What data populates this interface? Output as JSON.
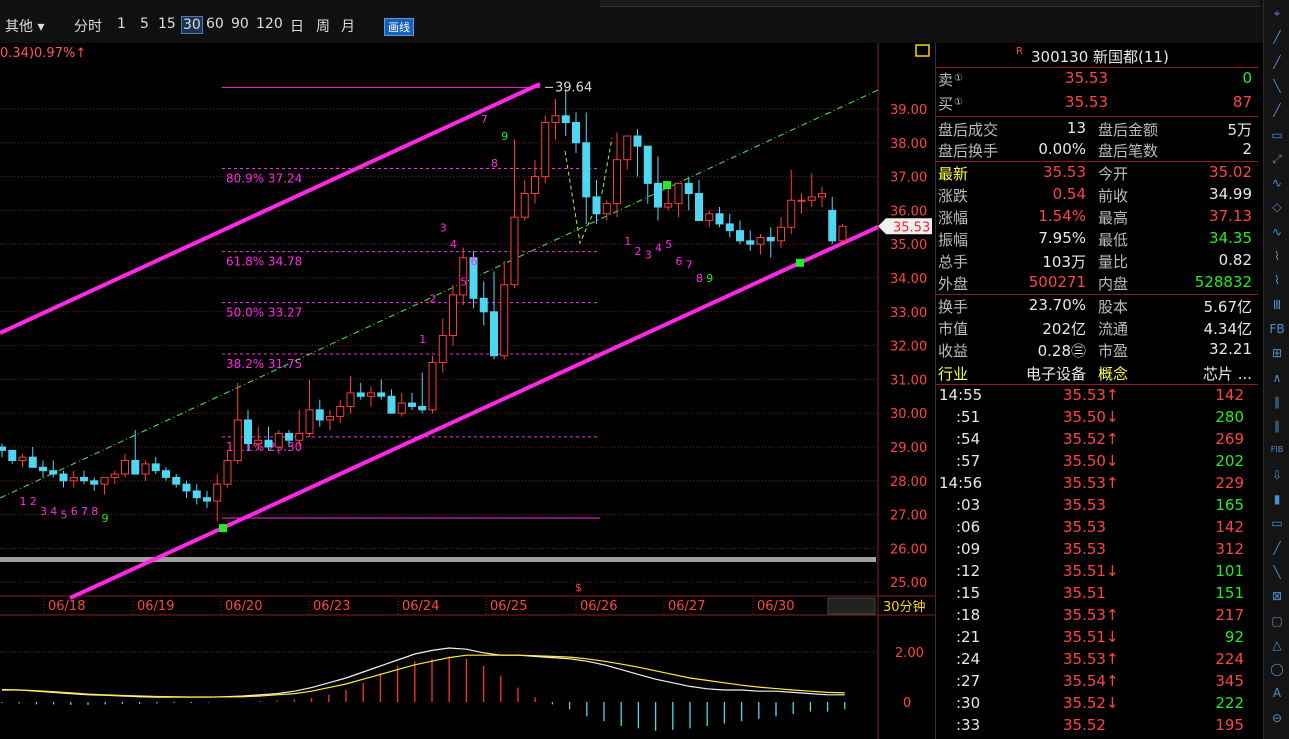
{
  "toolbar": {
    "other": "其他 ▾",
    "periods": [
      "分时",
      "1",
      "5",
      "15",
      "30",
      "60",
      "90",
      "120",
      "日",
      "周",
      "月"
    ],
    "active_period": "30",
    "draw_button": "画线"
  },
  "chart_info": {
    "change_text": "0.34)0.97%↑",
    "period_label": "30分钟",
    "current_price_tag": "35.53"
  },
  "colors": {
    "up": "#ff3b3b",
    "down": "#4fd6f0",
    "magenta": "#ff28e6",
    "grid": "#7a1c1c",
    "green_marker": "#22ee22"
  },
  "chart_data": {
    "type": "candlestick",
    "title": "",
    "y_ticks": [
      "39.00",
      "38.00",
      "37.00",
      "36.00",
      "35.00",
      "34.00",
      "33.00",
      "32.00",
      "31.00",
      "30.00",
      "29.00",
      "28.00",
      "27.00",
      "26.00",
      "25.00"
    ],
    "ylim": [
      24.5,
      40.4
    ],
    "x_labels": [
      "06/18",
      "06/19",
      "06/20",
      "06/23",
      "06/24",
      "06/25",
      "06/26",
      "06/27",
      "06/30"
    ],
    "high_annotation": "39.64",
    "fibonacci": [
      {
        "label": "80.9% 37.24",
        "value": 37.24
      },
      {
        "label": "61.8% 34.78",
        "value": 34.78
      },
      {
        "label": "50.0% 33.27",
        "value": 33.27
      },
      {
        "label": "38.2% 31.75",
        "value": 31.75
      },
      {
        "label": "19.1% 29.30",
        "value": 29.3
      }
    ],
    "candles": [
      [
        29.0,
        29.1,
        28.7,
        28.9
      ],
      [
        28.9,
        28.9,
        28.5,
        28.6
      ],
      [
        28.6,
        28.8,
        28.4,
        28.7
      ],
      [
        28.7,
        29.0,
        28.5,
        28.4
      ],
      [
        28.4,
        28.6,
        28.1,
        28.3
      ],
      [
        28.3,
        28.6,
        28.1,
        28.2
      ],
      [
        28.2,
        28.3,
        27.8,
        28.0
      ],
      [
        28.0,
        28.3,
        27.8,
        28.1
      ],
      [
        28.1,
        28.3,
        27.9,
        28.0
      ],
      [
        28.0,
        28.1,
        27.7,
        27.9
      ],
      [
        27.9,
        28.1,
        27.6,
        28.1
      ],
      [
        28.1,
        28.3,
        27.9,
        28.2
      ],
      [
        28.2,
        28.8,
        28.1,
        28.6
      ],
      [
        28.6,
        29.5,
        28.4,
        28.2
      ],
      [
        28.2,
        28.6,
        28.0,
        28.5
      ],
      [
        28.5,
        28.7,
        28.2,
        28.3
      ],
      [
        28.3,
        28.4,
        28.0,
        28.1
      ],
      [
        28.1,
        28.2,
        27.8,
        27.9
      ],
      [
        27.9,
        28.0,
        27.5,
        27.7
      ],
      [
        27.7,
        27.9,
        27.3,
        27.5
      ],
      [
        27.5,
        27.7,
        27.2,
        27.4
      ],
      [
        27.4,
        28.2,
        26.8,
        27.9
      ],
      [
        27.9,
        28.9,
        27.8,
        28.6
      ],
      [
        28.6,
        30.9,
        28.5,
        29.8
      ],
      [
        29.8,
        30.1,
        28.9,
        29.1
      ],
      [
        29.1,
        29.6,
        28.9,
        29.2
      ],
      [
        29.2,
        29.6,
        28.9,
        29.0
      ],
      [
        29.0,
        29.5,
        28.8,
        29.4
      ],
      [
        29.4,
        29.5,
        29.0,
        29.2
      ],
      [
        29.2,
        30.1,
        29.0,
        29.4
      ],
      [
        29.4,
        31.0,
        29.3,
        30.1
      ],
      [
        30.1,
        30.4,
        29.6,
        29.8
      ],
      [
        29.8,
        30.1,
        29.5,
        29.9
      ],
      [
        29.9,
        30.4,
        29.7,
        30.2
      ],
      [
        30.2,
        31.1,
        30.0,
        30.6
      ],
      [
        30.6,
        30.9,
        30.4,
        30.5
      ],
      [
        30.5,
        30.8,
        30.2,
        30.6
      ],
      [
        30.6,
        31.0,
        30.4,
        30.5
      ],
      [
        30.5,
        30.7,
        30.0,
        30.0
      ],
      [
        30.0,
        30.6,
        29.9,
        30.3
      ],
      [
        30.3,
        30.6,
        30.1,
        30.2
      ],
      [
        30.2,
        31.2,
        30.0,
        30.1
      ],
      [
        30.1,
        31.7,
        30.0,
        31.5
      ],
      [
        31.5,
        32.8,
        31.2,
        32.3
      ],
      [
        32.3,
        33.8,
        32.0,
        33.5
      ],
      [
        33.5,
        34.9,
        33.2,
        34.6
      ],
      [
        34.6,
        34.8,
        33.1,
        33.4
      ],
      [
        33.4,
        33.9,
        32.6,
        33.0
      ],
      [
        33.0,
        34.2,
        31.6,
        31.7
      ],
      [
        31.7,
        34.5,
        31.6,
        33.8
      ],
      [
        33.8,
        38.1,
        33.7,
        35.8
      ],
      [
        35.8,
        36.9,
        35.7,
        36.5
      ],
      [
        36.5,
        37.5,
        36.2,
        37.0
      ],
      [
        37.0,
        38.8,
        36.8,
        38.6
      ],
      [
        38.6,
        39.3,
        38.1,
        38.8
      ],
      [
        38.8,
        39.6,
        38.2,
        38.6
      ],
      [
        38.6,
        38.9,
        37.7,
        38.0
      ],
      [
        38.0,
        38.9,
        35.6,
        36.4
      ],
      [
        36.4,
        36.9,
        35.6,
        35.9
      ],
      [
        35.9,
        36.3,
        35.7,
        36.2
      ],
      [
        36.2,
        38.3,
        35.8,
        37.5
      ],
      [
        37.5,
        38.0,
        37.2,
        38.2
      ],
      [
        38.2,
        38.4,
        37.0,
        37.9
      ],
      [
        37.9,
        37.9,
        36.2,
        36.8
      ],
      [
        36.8,
        37.6,
        35.7,
        36.1
      ],
      [
        36.1,
        36.8,
        36.0,
        36.2
      ],
      [
        36.2,
        36.6,
        35.8,
        36.8
      ],
      [
        36.8,
        37.0,
        36.0,
        36.5
      ],
      [
        36.5,
        36.9,
        35.7,
        35.7
      ],
      [
        35.7,
        36.0,
        35.5,
        35.9
      ],
      [
        35.9,
        36.1,
        35.5,
        35.6
      ],
      [
        35.6,
        35.9,
        35.2,
        35.4
      ],
      [
        35.4,
        35.7,
        35.0,
        35.1
      ],
      [
        35.1,
        35.4,
        34.8,
        35.0
      ],
      [
        35.0,
        35.3,
        34.7,
        35.2
      ],
      [
        35.2,
        35.5,
        34.6,
        35.1
      ],
      [
        35.1,
        35.8,
        34.9,
        35.5
      ],
      [
        35.5,
        37.2,
        35.3,
        36.3
      ],
      [
        36.3,
        36.5,
        35.9,
        36.3
      ],
      [
        36.3,
        37.1,
        36.1,
        36.4
      ],
      [
        36.4,
        36.7,
        36.1,
        36.5
      ],
      [
        36.0,
        36.4,
        35.0,
        35.1
      ],
      [
        35.1,
        35.6,
        35.0,
        35.53
      ]
    ],
    "td_labels": [
      {
        "text": "1",
        "i": 2,
        "v": 27.4,
        "c": "m"
      },
      {
        "text": "2",
        "i": 3,
        "v": 27.4,
        "c": "m"
      },
      {
        "text": "3",
        "i": 4,
        "v": 27.1,
        "c": "m"
      },
      {
        "text": "4",
        "i": 5,
        "v": 27.1,
        "c": "m"
      },
      {
        "text": "5",
        "i": 6,
        "v": 27.0,
        "c": "m"
      },
      {
        "text": "6",
        "i": 7,
        "v": 27.1,
        "c": "m"
      },
      {
        "text": "7",
        "i": 8,
        "v": 27.1,
        "c": "m"
      },
      {
        "text": "8",
        "i": 9,
        "v": 27.1,
        "c": "m"
      },
      {
        "text": "9",
        "i": 10,
        "v": 26.9,
        "c": "g"
      },
      {
        "text": "1",
        "i": 41,
        "v": 32.2,
        "c": "m"
      },
      {
        "text": "2",
        "i": 42,
        "v": 33.4,
        "c": "m"
      },
      {
        "text": "3",
        "i": 43,
        "v": 35.5,
        "c": "m"
      },
      {
        "text": "4",
        "i": 44,
        "v": 35.0,
        "c": "m"
      },
      {
        "text": "5",
        "i": 45,
        "v": 33.9,
        "c": "m"
      },
      {
        "text": "6",
        "i": 46,
        "v": 34.5,
        "c": "m"
      },
      {
        "text": "7",
        "i": 47,
        "v": 38.7,
        "c": "m"
      },
      {
        "text": "8",
        "i": 48,
        "v": 37.4,
        "c": "m"
      },
      {
        "text": "9",
        "i": 49,
        "v": 38.2,
        "c": "g"
      },
      {
        "text": "1",
        "i": 61,
        "v": 35.1,
        "c": "m"
      },
      {
        "text": "2",
        "i": 62,
        "v": 34.8,
        "c": "m"
      },
      {
        "text": "3",
        "i": 63,
        "v": 34.7,
        "c": "m"
      },
      {
        "text": "4",
        "i": 64,
        "v": 34.9,
        "c": "m"
      },
      {
        "text": "5",
        "i": 65,
        "v": 35.0,
        "c": "m"
      },
      {
        "text": "6",
        "i": 66,
        "v": 34.5,
        "c": "m"
      },
      {
        "text": "7",
        "i": 67,
        "v": 34.4,
        "c": "m"
      },
      {
        "text": "8",
        "i": 68,
        "v": 34.0,
        "c": "m"
      },
      {
        "text": "9",
        "i": 69,
        "v": 34.0,
        "c": "g"
      }
    ],
    "macd": {
      "hist": [
        -0.02,
        -0.03,
        -0.05,
        -0.05,
        -0.06,
        -0.06,
        -0.05,
        -0.04,
        -0.04,
        -0.03,
        -0.02,
        -0.02,
        -0.01,
        0.0,
        0.01,
        0.02,
        0.03,
        0.05,
        0.08,
        0.15,
        0.25,
        0.4,
        0.6,
        0.75,
        0.85,
        0.9,
        0.95,
        0.9,
        0.75,
        0.55,
        0.3,
        0.1,
        -0.05,
        -0.15,
        -0.3,
        -0.4,
        -0.5,
        -0.55,
        -0.6,
        -0.58,
        -0.55,
        -0.5,
        -0.45,
        -0.4,
        -0.35,
        -0.3,
        -0.25,
        -0.2,
        -0.2,
        -0.15
      ],
      "dif": [
        0.5,
        0.5,
        0.45,
        0.4,
        0.35,
        0.3,
        0.28,
        0.25,
        0.22,
        0.2,
        0.2,
        0.2,
        0.2,
        0.22,
        0.25,
        0.3,
        0.35,
        0.45,
        0.6,
        0.8,
        1.0,
        1.25,
        1.5,
        1.75,
        2.0,
        2.15,
        2.25,
        2.2,
        2.05,
        1.95,
        1.95,
        1.9,
        1.85,
        1.8,
        1.7,
        1.55,
        1.35,
        1.15,
        0.95,
        0.8,
        0.65,
        0.55,
        0.5,
        0.5,
        0.45,
        0.45,
        0.4,
        0.35,
        0.3,
        0.3
      ],
      "dea": [
        0.52,
        0.5,
        0.47,
        0.43,
        0.38,
        0.33,
        0.3,
        0.27,
        0.25,
        0.23,
        0.22,
        0.21,
        0.21,
        0.21,
        0.22,
        0.25,
        0.3,
        0.35,
        0.45,
        0.6,
        0.75,
        0.95,
        1.15,
        1.35,
        1.55,
        1.7,
        1.85,
        1.95,
        1.95,
        1.95,
        1.95,
        1.93,
        1.9,
        1.87,
        1.8,
        1.7,
        1.58,
        1.45,
        1.3,
        1.15,
        1.0,
        0.9,
        0.8,
        0.7,
        0.62,
        0.56,
        0.5,
        0.45,
        0.4,
        0.38
      ]
    },
    "macd_ticks": [
      "2.00",
      "0"
    ]
  },
  "quote": {
    "code_title": "300130 新国都(11)",
    "r_mark": "R",
    "sell": {
      "label": "卖",
      "price": "35.53",
      "vol": "0"
    },
    "buy": {
      "label": "买",
      "price": "35.53",
      "vol": "87"
    },
    "after_hours": [
      {
        "l1": "盘后成交",
        "v1": "13",
        "l2": "盘后金额",
        "v2": "5万"
      },
      {
        "l1": "盘后换手",
        "v1": "0.00%",
        "l2": "盘后笔数",
        "v2": "2"
      }
    ],
    "stats": [
      {
        "l1": "最新",
        "v1": "35.53",
        "c1": "red",
        "l2": "今开",
        "v2": "35.02",
        "c2": "red"
      },
      {
        "l1": "涨跌",
        "v1": "0.54",
        "c1": "red",
        "l2": "前收",
        "v2": "34.99",
        "c2": "wht"
      },
      {
        "l1": "涨幅",
        "v1": "1.54%",
        "c1": "red",
        "l2": "最高",
        "v2": "37.13",
        "c2": "red"
      },
      {
        "l1": "振幅",
        "v1": "7.95%",
        "c1": "wht",
        "l2": "最低",
        "v2": "34.35",
        "c2": "grn"
      },
      {
        "l1": "总手",
        "v1": "103万",
        "c1": "wht",
        "l2": "量比",
        "v2": "0.82",
        "c2": "wht"
      },
      {
        "l1": "外盘",
        "v1": "500271",
        "c1": "red",
        "l2": "内盘",
        "v2": "528832",
        "c2": "grn"
      }
    ],
    "stats2": [
      {
        "l1": "换手",
        "v1": "23.70%",
        "l2": "股本",
        "v2": "5.67亿"
      },
      {
        "l1": "市值",
        "v1": "202亿",
        "l2": "流通",
        "v2": "4.34亿"
      },
      {
        "l1": "收益",
        "v1": "0.28㊂",
        "l2": "市盈",
        "v2": "32.21"
      }
    ],
    "industry": {
      "l1": "行业",
      "v1": "电子设备",
      "l2": "概念",
      "v2": "芯片 ..."
    }
  },
  "ticks": [
    {
      "t": "14:55",
      "p": "35.53↑",
      "pc": "red",
      "v": "142",
      "vc": "red"
    },
    {
      "t": ":51",
      "p": "35.50↓",
      "pc": "red",
      "v": "280",
      "vc": "grn"
    },
    {
      "t": ":54",
      "p": "35.52↑",
      "pc": "red",
      "v": "269",
      "vc": "red"
    },
    {
      "t": ":57",
      "p": "35.50↓",
      "pc": "red",
      "v": "202",
      "vc": "grn"
    },
    {
      "t": "14:56",
      "p": "35.53↑",
      "pc": "red",
      "v": "229",
      "vc": "red"
    },
    {
      "t": ":03",
      "p": "35.53",
      "pc": "red",
      "v": "165",
      "vc": "grn"
    },
    {
      "t": ":06",
      "p": "35.53",
      "pc": "red",
      "v": "142",
      "vc": "red"
    },
    {
      "t": ":09",
      "p": "35.53",
      "pc": "red",
      "v": "312",
      "vc": "red"
    },
    {
      "t": ":12",
      "p": "35.51↓",
      "pc": "red",
      "v": "101",
      "vc": "grn"
    },
    {
      "t": ":15",
      "p": "35.51",
      "pc": "red",
      "v": "151",
      "vc": "grn"
    },
    {
      "t": ":18",
      "p": "35.53↑",
      "pc": "red",
      "v": "217",
      "vc": "red"
    },
    {
      "t": ":21",
      "p": "35.51↓",
      "pc": "red",
      "v": "92",
      "vc": "grn"
    },
    {
      "t": ":24",
      "p": "35.53↑",
      "pc": "red",
      "v": "224",
      "vc": "red"
    },
    {
      "t": ":27",
      "p": "35.54↑",
      "pc": "red",
      "v": "345",
      "vc": "red"
    },
    {
      "t": ":30",
      "p": "35.52↓",
      "pc": "red",
      "v": "222",
      "vc": "grn"
    },
    {
      "t": ":33",
      "p": "35.52",
      "pc": "red",
      "v": "195",
      "vc": "red"
    }
  ],
  "side_tools": [
    "⌖",
    "╱",
    "╱",
    "╲",
    "╱",
    "▭",
    "⤢",
    "∿",
    "◇",
    "∿",
    "⌇",
    "⌇",
    "Ⅲ",
    "FB",
    "⊞",
    "∧",
    "∥",
    "∥",
    "FIB",
    "⇩",
    "▮",
    "▭",
    "╱",
    "╲",
    "⊠",
    "▢",
    "△",
    "◯",
    "A",
    "⊖"
  ]
}
